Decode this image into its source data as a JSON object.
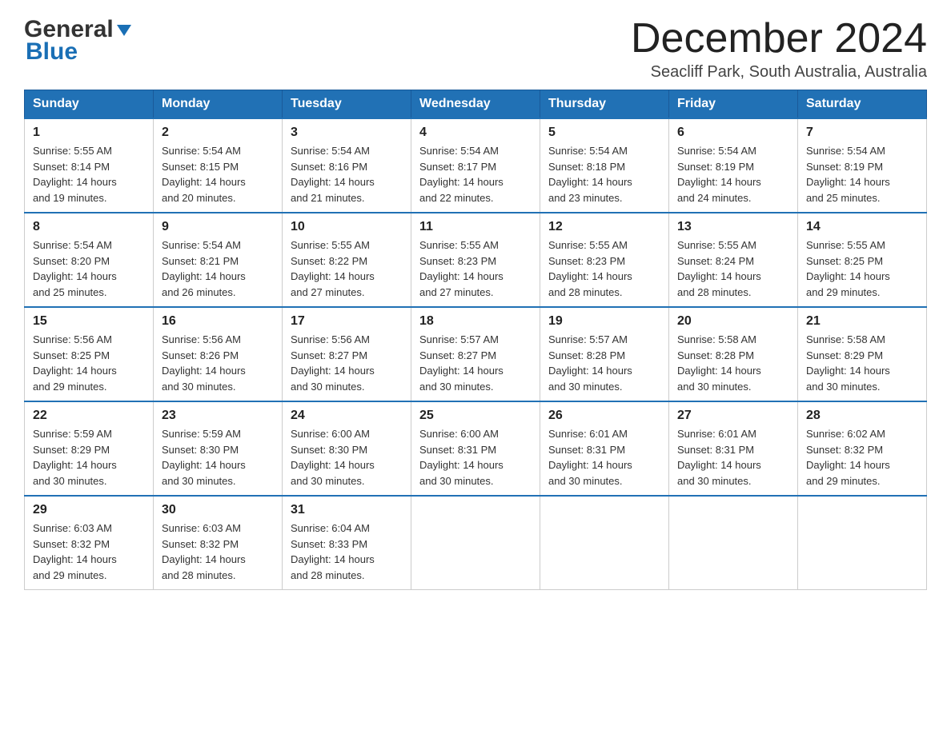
{
  "header": {
    "logo_general": "General",
    "logo_blue": "Blue",
    "month_title": "December 2024",
    "location": "Seacliff Park, South Australia, Australia"
  },
  "days_of_week": [
    "Sunday",
    "Monday",
    "Tuesday",
    "Wednesday",
    "Thursday",
    "Friday",
    "Saturday"
  ],
  "weeks": [
    [
      {
        "day": "1",
        "sunrise": "5:55 AM",
        "sunset": "8:14 PM",
        "daylight": "14 hours and 19 minutes."
      },
      {
        "day": "2",
        "sunrise": "5:54 AM",
        "sunset": "8:15 PM",
        "daylight": "14 hours and 20 minutes."
      },
      {
        "day": "3",
        "sunrise": "5:54 AM",
        "sunset": "8:16 PM",
        "daylight": "14 hours and 21 minutes."
      },
      {
        "day": "4",
        "sunrise": "5:54 AM",
        "sunset": "8:17 PM",
        "daylight": "14 hours and 22 minutes."
      },
      {
        "day": "5",
        "sunrise": "5:54 AM",
        "sunset": "8:18 PM",
        "daylight": "14 hours and 23 minutes."
      },
      {
        "day": "6",
        "sunrise": "5:54 AM",
        "sunset": "8:19 PM",
        "daylight": "14 hours and 24 minutes."
      },
      {
        "day": "7",
        "sunrise": "5:54 AM",
        "sunset": "8:19 PM",
        "daylight": "14 hours and 25 minutes."
      }
    ],
    [
      {
        "day": "8",
        "sunrise": "5:54 AM",
        "sunset": "8:20 PM",
        "daylight": "14 hours and 25 minutes."
      },
      {
        "day": "9",
        "sunrise": "5:54 AM",
        "sunset": "8:21 PM",
        "daylight": "14 hours and 26 minutes."
      },
      {
        "day": "10",
        "sunrise": "5:55 AM",
        "sunset": "8:22 PM",
        "daylight": "14 hours and 27 minutes."
      },
      {
        "day": "11",
        "sunrise": "5:55 AM",
        "sunset": "8:23 PM",
        "daylight": "14 hours and 27 minutes."
      },
      {
        "day": "12",
        "sunrise": "5:55 AM",
        "sunset": "8:23 PM",
        "daylight": "14 hours and 28 minutes."
      },
      {
        "day": "13",
        "sunrise": "5:55 AM",
        "sunset": "8:24 PM",
        "daylight": "14 hours and 28 minutes."
      },
      {
        "day": "14",
        "sunrise": "5:55 AM",
        "sunset": "8:25 PM",
        "daylight": "14 hours and 29 minutes."
      }
    ],
    [
      {
        "day": "15",
        "sunrise": "5:56 AM",
        "sunset": "8:25 PM",
        "daylight": "14 hours and 29 minutes."
      },
      {
        "day": "16",
        "sunrise": "5:56 AM",
        "sunset": "8:26 PM",
        "daylight": "14 hours and 30 minutes."
      },
      {
        "day": "17",
        "sunrise": "5:56 AM",
        "sunset": "8:27 PM",
        "daylight": "14 hours and 30 minutes."
      },
      {
        "day": "18",
        "sunrise": "5:57 AM",
        "sunset": "8:27 PM",
        "daylight": "14 hours and 30 minutes."
      },
      {
        "day": "19",
        "sunrise": "5:57 AM",
        "sunset": "8:28 PM",
        "daylight": "14 hours and 30 minutes."
      },
      {
        "day": "20",
        "sunrise": "5:58 AM",
        "sunset": "8:28 PM",
        "daylight": "14 hours and 30 minutes."
      },
      {
        "day": "21",
        "sunrise": "5:58 AM",
        "sunset": "8:29 PM",
        "daylight": "14 hours and 30 minutes."
      }
    ],
    [
      {
        "day": "22",
        "sunrise": "5:59 AM",
        "sunset": "8:29 PM",
        "daylight": "14 hours and 30 minutes."
      },
      {
        "day": "23",
        "sunrise": "5:59 AM",
        "sunset": "8:30 PM",
        "daylight": "14 hours and 30 minutes."
      },
      {
        "day": "24",
        "sunrise": "6:00 AM",
        "sunset": "8:30 PM",
        "daylight": "14 hours and 30 minutes."
      },
      {
        "day": "25",
        "sunrise": "6:00 AM",
        "sunset": "8:31 PM",
        "daylight": "14 hours and 30 minutes."
      },
      {
        "day": "26",
        "sunrise": "6:01 AM",
        "sunset": "8:31 PM",
        "daylight": "14 hours and 30 minutes."
      },
      {
        "day": "27",
        "sunrise": "6:01 AM",
        "sunset": "8:31 PM",
        "daylight": "14 hours and 30 minutes."
      },
      {
        "day": "28",
        "sunrise": "6:02 AM",
        "sunset": "8:32 PM",
        "daylight": "14 hours and 29 minutes."
      }
    ],
    [
      {
        "day": "29",
        "sunrise": "6:03 AM",
        "sunset": "8:32 PM",
        "daylight": "14 hours and 29 minutes."
      },
      {
        "day": "30",
        "sunrise": "6:03 AM",
        "sunset": "8:32 PM",
        "daylight": "14 hours and 28 minutes."
      },
      {
        "day": "31",
        "sunrise": "6:04 AM",
        "sunset": "8:33 PM",
        "daylight": "14 hours and 28 minutes."
      },
      null,
      null,
      null,
      null
    ]
  ],
  "labels": {
    "sunrise": "Sunrise:",
    "sunset": "Sunset:",
    "daylight": "Daylight:"
  }
}
